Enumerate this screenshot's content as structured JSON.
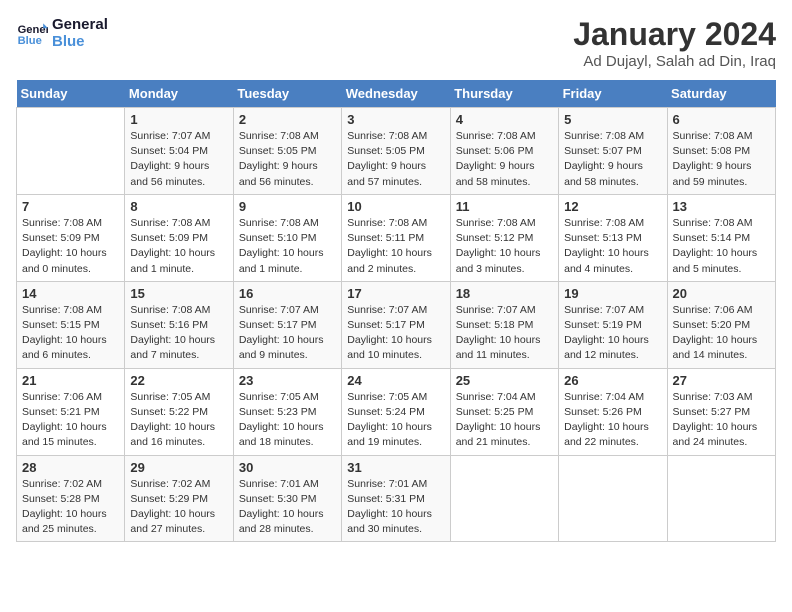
{
  "header": {
    "logo_line1": "General",
    "logo_line2": "Blue",
    "title": "January 2024",
    "subtitle": "Ad Dujayl, Salah ad Din, Iraq"
  },
  "calendar": {
    "days_of_week": [
      "Sunday",
      "Monday",
      "Tuesday",
      "Wednesday",
      "Thursday",
      "Friday",
      "Saturday"
    ],
    "weeks": [
      [
        {
          "date": "",
          "sunrise": "",
          "sunset": "",
          "daylight": ""
        },
        {
          "date": "1",
          "sunrise": "Sunrise: 7:07 AM",
          "sunset": "Sunset: 5:04 PM",
          "daylight": "Daylight: 9 hours and 56 minutes."
        },
        {
          "date": "2",
          "sunrise": "Sunrise: 7:08 AM",
          "sunset": "Sunset: 5:05 PM",
          "daylight": "Daylight: 9 hours and 56 minutes."
        },
        {
          "date": "3",
          "sunrise": "Sunrise: 7:08 AM",
          "sunset": "Sunset: 5:05 PM",
          "daylight": "Daylight: 9 hours and 57 minutes."
        },
        {
          "date": "4",
          "sunrise": "Sunrise: 7:08 AM",
          "sunset": "Sunset: 5:06 PM",
          "daylight": "Daylight: 9 hours and 58 minutes."
        },
        {
          "date": "5",
          "sunrise": "Sunrise: 7:08 AM",
          "sunset": "Sunset: 5:07 PM",
          "daylight": "Daylight: 9 hours and 58 minutes."
        },
        {
          "date": "6",
          "sunrise": "Sunrise: 7:08 AM",
          "sunset": "Sunset: 5:08 PM",
          "daylight": "Daylight: 9 hours and 59 minutes."
        }
      ],
      [
        {
          "date": "7",
          "sunrise": "Sunrise: 7:08 AM",
          "sunset": "Sunset: 5:09 PM",
          "daylight": "Daylight: 10 hours and 0 minutes."
        },
        {
          "date": "8",
          "sunrise": "Sunrise: 7:08 AM",
          "sunset": "Sunset: 5:09 PM",
          "daylight": "Daylight: 10 hours and 1 minute."
        },
        {
          "date": "9",
          "sunrise": "Sunrise: 7:08 AM",
          "sunset": "Sunset: 5:10 PM",
          "daylight": "Daylight: 10 hours and 1 minute."
        },
        {
          "date": "10",
          "sunrise": "Sunrise: 7:08 AM",
          "sunset": "Sunset: 5:11 PM",
          "daylight": "Daylight: 10 hours and 2 minutes."
        },
        {
          "date": "11",
          "sunrise": "Sunrise: 7:08 AM",
          "sunset": "Sunset: 5:12 PM",
          "daylight": "Daylight: 10 hours and 3 minutes."
        },
        {
          "date": "12",
          "sunrise": "Sunrise: 7:08 AM",
          "sunset": "Sunset: 5:13 PM",
          "daylight": "Daylight: 10 hours and 4 minutes."
        },
        {
          "date": "13",
          "sunrise": "Sunrise: 7:08 AM",
          "sunset": "Sunset: 5:14 PM",
          "daylight": "Daylight: 10 hours and 5 minutes."
        }
      ],
      [
        {
          "date": "14",
          "sunrise": "Sunrise: 7:08 AM",
          "sunset": "Sunset: 5:15 PM",
          "daylight": "Daylight: 10 hours and 6 minutes."
        },
        {
          "date": "15",
          "sunrise": "Sunrise: 7:08 AM",
          "sunset": "Sunset: 5:16 PM",
          "daylight": "Daylight: 10 hours and 7 minutes."
        },
        {
          "date": "16",
          "sunrise": "Sunrise: 7:07 AM",
          "sunset": "Sunset: 5:17 PM",
          "daylight": "Daylight: 10 hours and 9 minutes."
        },
        {
          "date": "17",
          "sunrise": "Sunrise: 7:07 AM",
          "sunset": "Sunset: 5:17 PM",
          "daylight": "Daylight: 10 hours and 10 minutes."
        },
        {
          "date": "18",
          "sunrise": "Sunrise: 7:07 AM",
          "sunset": "Sunset: 5:18 PM",
          "daylight": "Daylight: 10 hours and 11 minutes."
        },
        {
          "date": "19",
          "sunrise": "Sunrise: 7:07 AM",
          "sunset": "Sunset: 5:19 PM",
          "daylight": "Daylight: 10 hours and 12 minutes."
        },
        {
          "date": "20",
          "sunrise": "Sunrise: 7:06 AM",
          "sunset": "Sunset: 5:20 PM",
          "daylight": "Daylight: 10 hours and 14 minutes."
        }
      ],
      [
        {
          "date": "21",
          "sunrise": "Sunrise: 7:06 AM",
          "sunset": "Sunset: 5:21 PM",
          "daylight": "Daylight: 10 hours and 15 minutes."
        },
        {
          "date": "22",
          "sunrise": "Sunrise: 7:05 AM",
          "sunset": "Sunset: 5:22 PM",
          "daylight": "Daylight: 10 hours and 16 minutes."
        },
        {
          "date": "23",
          "sunrise": "Sunrise: 7:05 AM",
          "sunset": "Sunset: 5:23 PM",
          "daylight": "Daylight: 10 hours and 18 minutes."
        },
        {
          "date": "24",
          "sunrise": "Sunrise: 7:05 AM",
          "sunset": "Sunset: 5:24 PM",
          "daylight": "Daylight: 10 hours and 19 minutes."
        },
        {
          "date": "25",
          "sunrise": "Sunrise: 7:04 AM",
          "sunset": "Sunset: 5:25 PM",
          "daylight": "Daylight: 10 hours and 21 minutes."
        },
        {
          "date": "26",
          "sunrise": "Sunrise: 7:04 AM",
          "sunset": "Sunset: 5:26 PM",
          "daylight": "Daylight: 10 hours and 22 minutes."
        },
        {
          "date": "27",
          "sunrise": "Sunrise: 7:03 AM",
          "sunset": "Sunset: 5:27 PM",
          "daylight": "Daylight: 10 hours and 24 minutes."
        }
      ],
      [
        {
          "date": "28",
          "sunrise": "Sunrise: 7:02 AM",
          "sunset": "Sunset: 5:28 PM",
          "daylight": "Daylight: 10 hours and 25 minutes."
        },
        {
          "date": "29",
          "sunrise": "Sunrise: 7:02 AM",
          "sunset": "Sunset: 5:29 PM",
          "daylight": "Daylight: 10 hours and 27 minutes."
        },
        {
          "date": "30",
          "sunrise": "Sunrise: 7:01 AM",
          "sunset": "Sunset: 5:30 PM",
          "daylight": "Daylight: 10 hours and 28 minutes."
        },
        {
          "date": "31",
          "sunrise": "Sunrise: 7:01 AM",
          "sunset": "Sunset: 5:31 PM",
          "daylight": "Daylight: 10 hours and 30 minutes."
        },
        {
          "date": "",
          "sunrise": "",
          "sunset": "",
          "daylight": ""
        },
        {
          "date": "",
          "sunrise": "",
          "sunset": "",
          "daylight": ""
        },
        {
          "date": "",
          "sunrise": "",
          "sunset": "",
          "daylight": ""
        }
      ]
    ]
  }
}
